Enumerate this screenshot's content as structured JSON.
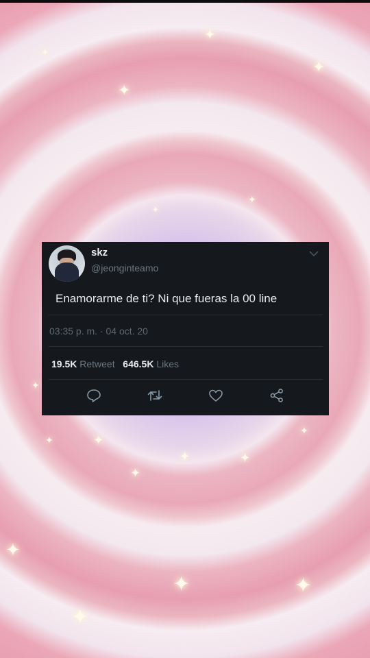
{
  "tweet": {
    "display_name": "skz",
    "handle": "@jeonginteamo",
    "text_part1": "Enamorarme de ti? ",
    "text_part2": "Ni que fueras la 00 line",
    "timestamp": "03:35 p. m. · 04 oct. 20",
    "retweets_count": "19.5K",
    "retweets_label": "Retweet",
    "likes_count": "646.5K",
    "likes_label": "Likes"
  },
  "icons": {
    "chevron": "chevron-down-icon",
    "reply": "reply-icon",
    "retweet": "retweet-icon",
    "like": "heart-icon",
    "share": "share-icon"
  },
  "colors": {
    "card_background": "#15181c",
    "primary_text": "#e8eaed",
    "secondary_text": "#6d7780",
    "icon": "#8899a6",
    "background_pink": "#e9a8b8",
    "background_lilac": "#d9c6ea"
  }
}
